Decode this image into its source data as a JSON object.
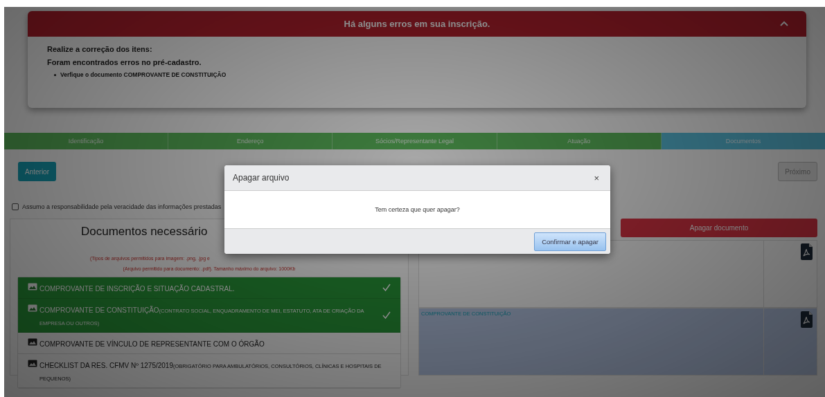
{
  "alert": {
    "title": "Há alguns erros em sua inscrição.",
    "expanded": true,
    "lines": [
      "Realize a correção dos itens:",
      "Foram encontrados erros no pré-cadastro."
    ],
    "items": [
      "Verfique o documento COMPROVANTE DE CONSTITUIÇÃO"
    ]
  },
  "steps": [
    {
      "label": "Identificação",
      "selected": false
    },
    {
      "label": "Endereço",
      "selected": false
    },
    {
      "label": "Sócios/Representante Legal",
      "selected": false
    },
    {
      "label": "Atuação",
      "selected": false
    },
    {
      "label": "Documentos",
      "selected": true
    }
  ],
  "nav": {
    "previous": {
      "label": "Anterior",
      "disabled": false
    },
    "next": {
      "label": "Próximo",
      "disabled": true
    }
  },
  "agreement": {
    "label": "Assumo a responsabilidade pela veracidade das informações prestadas",
    "checked": false
  },
  "documents": {
    "title": "Documentos necessário",
    "notes": [
      "(Tipos de arquivos permitidos para imagem: .png, .jpg e",
      "(Arquivo permitido para documento: .pdf). Tamanho máximo do arquivo: 1000Kb"
    ],
    "items": [
      {
        "label": "COMPROVANTE DE INSCRIÇÃO E SITUAÇÃO CADASTRAL.",
        "uploaded": true
      },
      {
        "label": "COMPROVANTE DE CONSTITUIÇÃO",
        "detail": "(CONTRATO SOCIAL, ENQUADRAMENTO DE MEI, ESTATUTO, ATA DE CRIAÇÃO DA EMPRESA OU OUTROS)",
        "uploaded": true
      },
      {
        "label": "COMPROVANTE DE VÍNCULO DE REPRESENTANTE COM O ÓRGÃO",
        "uploaded": false
      },
      {
        "label": "CHECKLIST DA RES. CFMV Nº 1275/2019",
        "detail": "(OBRIGATÓRIO PARA AMBULATÓRIOS, CONSULTÓRIOS, CLÍNICAS E HOSPITAIS DE PEQUENOS)",
        "uploaded": false
      }
    ]
  },
  "delete_button": "Apagar documento",
  "files": [
    {
      "selected": false
    },
    {
      "caption": "COMPROVANTE DE CONSTITUIÇÃO",
      "selected": true
    }
  ],
  "modal": {
    "title": "Apagar arquivo",
    "close": "×",
    "message": "Tem certeza que quer apagar?",
    "confirm": "Confirmar e apagar"
  }
}
